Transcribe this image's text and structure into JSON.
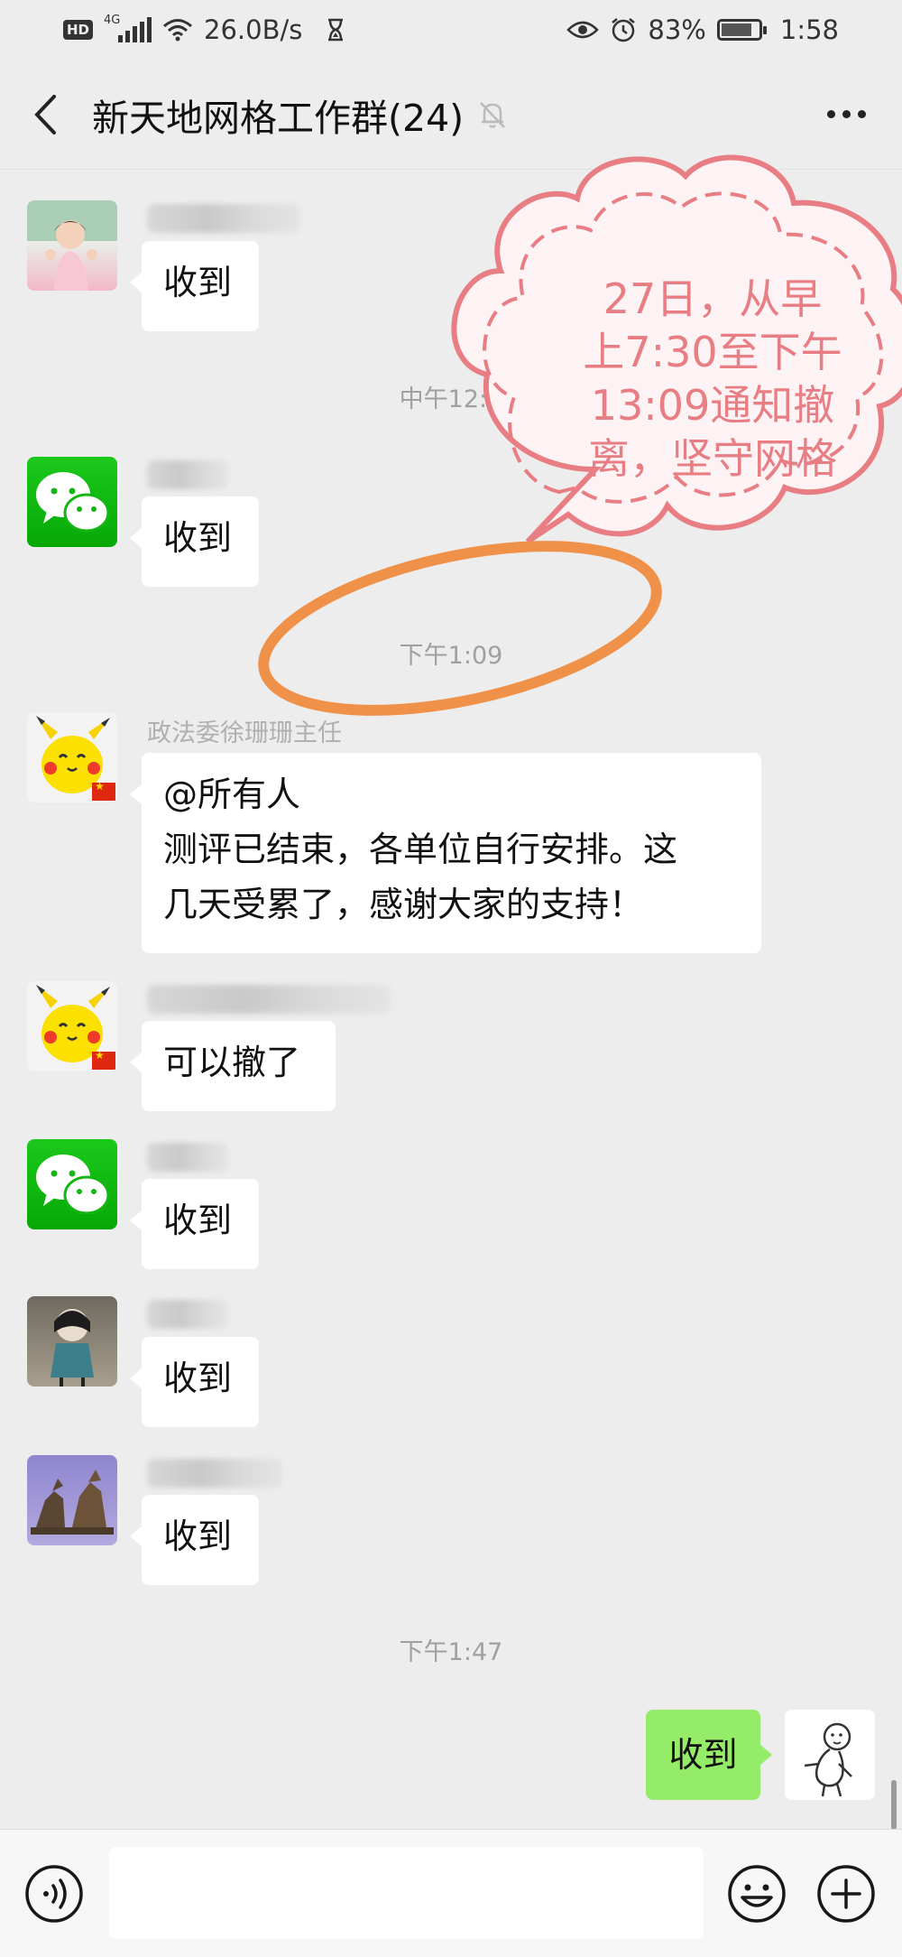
{
  "status_bar": {
    "hd": "HD",
    "network": "4G",
    "speed": "26.0B/s",
    "battery_percent": "83%",
    "battery_level": 0.83,
    "time": "1:58"
  },
  "header": {
    "title": "新天地网格工作群(24)"
  },
  "timestamps": {
    "t1": "中午12:1",
    "t2": "下午1:09",
    "t3": "下午1:47"
  },
  "messages": {
    "m1": "收到",
    "m2": "收到",
    "m3_sender": "政法委徐珊珊主任",
    "m3_line1": "@所有人",
    "m3_line2": "测评已结束，各单位自行安排。这",
    "m3_line3": "几天受累了，感谢大家的支持！",
    "m4": "可以撤了",
    "m5": "收到",
    "m6": "收到",
    "m7": "收到",
    "mine": "收到"
  },
  "annotation": {
    "line1": "27日，从早",
    "line2": "上7:30至下午",
    "line3": "13:09通知撤",
    "line4": "离，坚守网格",
    "color_text": "#e87d84",
    "color_circle": "#f0914a"
  },
  "colors": {
    "bg": "#ededed",
    "my_bubble": "#95ec69",
    "other_bubble": "#ffffff"
  }
}
